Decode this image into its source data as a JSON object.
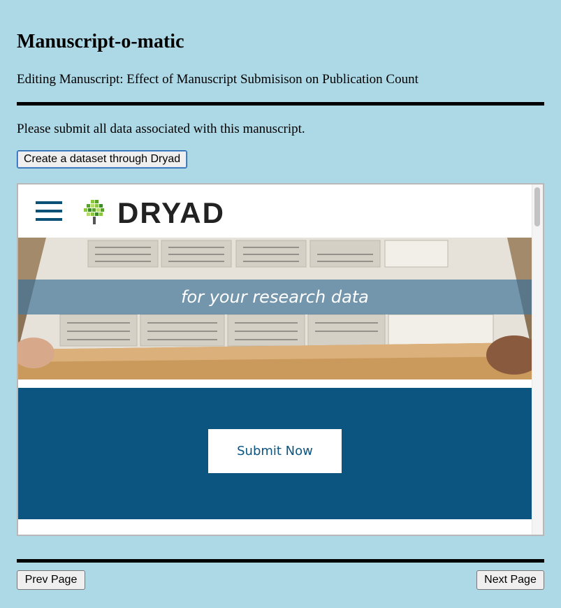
{
  "app": {
    "title": "Manuscript-o-matic",
    "subtitle": "Editing Manuscript: Effect of Manuscript Submisison on Publication Count"
  },
  "content": {
    "instructions": "Please submit all data associated with this manuscript.",
    "create_dataset_label": "Create a dataset through Dryad"
  },
  "embedded_site": {
    "logo_text": "DRYAD",
    "tagline": "for your research data",
    "submit_label": "Submit Now",
    "brand_color": "#0b5580",
    "hero_image": "specimen-drawer-photo"
  },
  "nav": {
    "prev_label": "Prev Page",
    "next_label": "Next Page"
  },
  "colors": {
    "page_background": "#add8e6",
    "rule": "#000000"
  }
}
